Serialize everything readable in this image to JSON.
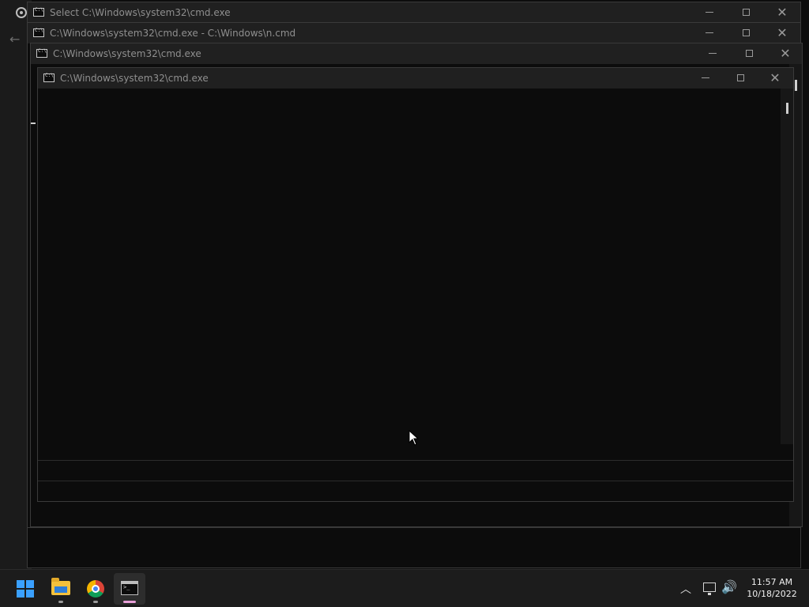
{
  "windows": [
    {
      "title": "Select C:\\Windows\\system32\\cmd.exe"
    },
    {
      "title": "C:\\Windows\\system32\\cmd.exe - C:\\Windows\\n.cmd"
    },
    {
      "title": "C:\\Windows\\system32\\cmd.exe"
    },
    {
      "title": "C:\\Windows\\system32\\cmd.exe"
    }
  ],
  "taskbar": {
    "items": [
      {
        "name": "start",
        "icon": "windows-logo-icon"
      },
      {
        "name": "file-explorer",
        "icon": "folder-icon"
      },
      {
        "name": "chrome",
        "icon": "chrome-icon"
      },
      {
        "name": "command-prompt",
        "icon": "terminal-icon"
      }
    ],
    "tray": {
      "chevron": "^",
      "volume": "🔊"
    },
    "clock": {
      "time": "11:57 AM",
      "date": "10/18/2022"
    }
  },
  "colors": {
    "console_bg": "#0c0c0c",
    "titlebar_bg": "#202020",
    "taskbar_bg": "#1c1c1c",
    "accent": "#3aa0ff"
  }
}
